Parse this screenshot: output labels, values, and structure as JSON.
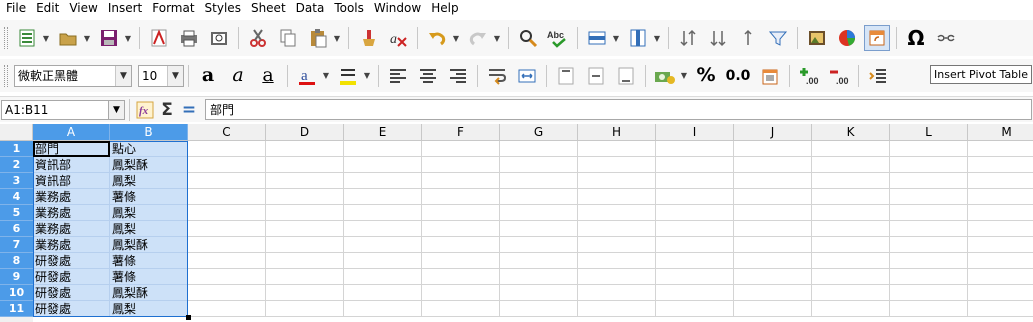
{
  "menu": [
    "File",
    "Edit",
    "View",
    "Insert",
    "Format",
    "Styles",
    "Sheet",
    "Data",
    "Tools",
    "Window",
    "Help"
  ],
  "toolbar2": {
    "font_name": "微軟正黑體",
    "font_size": "10",
    "percent_label": "%",
    "decimal_label": "0.0"
  },
  "tooltip": "Insert Pivot Table",
  "formula_bar": {
    "name_box": "A1:B11",
    "content": "部門"
  },
  "sheet": {
    "columns": [
      "A",
      "B",
      "C",
      "D",
      "E",
      "F",
      "G",
      "H",
      "I",
      "J",
      "K",
      "L",
      "M"
    ],
    "rows": [
      {
        "num": "1",
        "a": "部門",
        "b": "點心"
      },
      {
        "num": "2",
        "a": "資訊部",
        "b": "鳳梨酥"
      },
      {
        "num": "3",
        "a": "資訊部",
        "b": "鳳梨"
      },
      {
        "num": "4",
        "a": "業務處",
        "b": "薯條"
      },
      {
        "num": "5",
        "a": "業務處",
        "b": "鳳梨"
      },
      {
        "num": "6",
        "a": "業務處",
        "b": "鳳梨"
      },
      {
        "num": "7",
        "a": "業務處",
        "b": "鳳梨酥"
      },
      {
        "num": "8",
        "a": "研發處",
        "b": "薯條"
      },
      {
        "num": "9",
        "a": "研發處",
        "b": "薯條"
      },
      {
        "num": "10",
        "a": "研發處",
        "b": "鳳梨酥"
      },
      {
        "num": "11",
        "a": "研發處",
        "b": "鳳梨"
      }
    ]
  },
  "colors": {
    "selection_header": "#4c9be8",
    "selection_fill": "#cde1f8"
  }
}
